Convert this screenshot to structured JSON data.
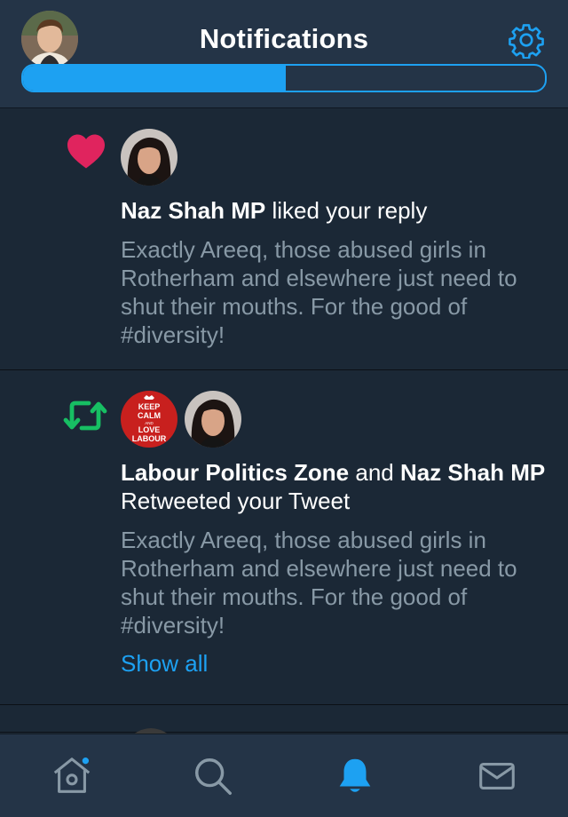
{
  "header": {
    "title": "Notifications",
    "avatar_icon": "profile-avatar",
    "settings_icon": "gear-icon"
  },
  "tabs": {
    "active_index": 0
  },
  "notifications": [
    {
      "type": "like",
      "icon": "heart-icon",
      "actors": [
        {
          "name": "Naz Shah MP",
          "avatar": "naz-shah-avatar"
        }
      ],
      "actor_text": "Naz Shah MP",
      "action_text": " liked your reply",
      "tweet_text": "Exactly Areeq, those abused girls in Rotherham and elsewhere just need to shut their mouths. For the good of #diversity!"
    },
    {
      "type": "retweet",
      "icon": "retweet-icon",
      "actors": [
        {
          "name": "Labour Politics Zone",
          "avatar": "keep-calm-love-labour-avatar"
        },
        {
          "name": "Naz Shah MP",
          "avatar": "naz-shah-avatar"
        }
      ],
      "actor1_text": "Labour Politics Zone",
      "joiner_text": " and ",
      "actor2_text": "Naz Shah MP",
      "action_text": " Retweeted your Tweet",
      "tweet_text": "Exactly Areeq, those abused girls in Rotherham and elsewhere just need to shut their mouths. For the good of #diversity!",
      "show_all_label": "Show all",
      "avatar_lettering": [
        "KEEP",
        "CALM",
        "AND",
        "LOVE",
        "LABOUR"
      ]
    }
  ],
  "tabbar": {
    "items": [
      {
        "name": "home",
        "icon": "home-icon",
        "has_badge": true
      },
      {
        "name": "search",
        "icon": "search-icon"
      },
      {
        "name": "notifications",
        "icon": "bell-icon",
        "active": true
      },
      {
        "name": "messages",
        "icon": "mail-icon"
      }
    ]
  },
  "colors": {
    "background": "#1b2836",
    "header": "#243447",
    "accent": "#1da1f2",
    "like": "#e0245e",
    "retweet": "#17bf63",
    "muted_text": "#8899a6"
  }
}
